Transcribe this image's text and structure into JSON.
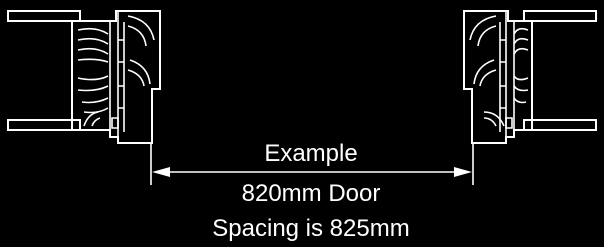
{
  "labels": {
    "example": "Example",
    "door_size": "820mm Door",
    "spacing": "Spacing is 825mm"
  },
  "colors": {
    "background": "#000000",
    "line": "#ffffff"
  }
}
